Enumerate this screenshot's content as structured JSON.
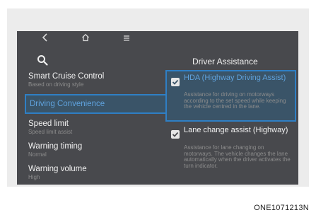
{
  "nav": {
    "back_icon": "chevron-left-icon",
    "home_icon": "home-icon",
    "menu_icon": "menu-icon"
  },
  "left_menu": {
    "items": [
      {
        "title": "Smart Cruise Control",
        "subtitle": "Based on driving style"
      },
      {
        "title": "Driving Convenience",
        "subtitle": ""
      },
      {
        "title": "Speed limit",
        "subtitle": "Speed limit assist"
      },
      {
        "title": "Warning timing",
        "subtitle": "Normal"
      },
      {
        "title": "Warning volume",
        "subtitle": "High"
      }
    ]
  },
  "right_panel": {
    "title": "Driver Assistance",
    "options": [
      {
        "title": "HDA (Highway Driving Assist)",
        "description": "Assistance for driving on motorways according to the set speed while keeping the vehicle centred in the lane.",
        "checked": true
      },
      {
        "title": "Lane change assist (Highway)",
        "description": "Assistance for lane changing on motorways. The vehicle changes the lane automatically when the driver activates the turn indicator.",
        "checked": true
      }
    ]
  },
  "caption": "ONE1071213N",
  "colors": {
    "screen_bg": "#48494d",
    "accent": "#2f7fc4",
    "highlight_text": "#5fa2dd"
  }
}
